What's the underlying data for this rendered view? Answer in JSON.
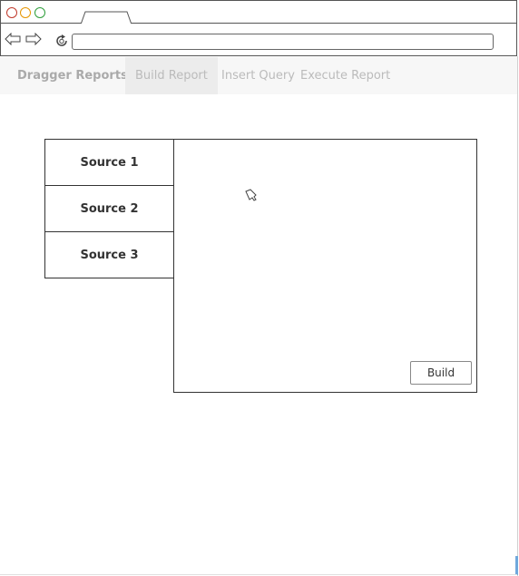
{
  "app": {
    "brand": "Dragger Reports",
    "nav": [
      {
        "label": "Build Report",
        "active": true
      },
      {
        "label": "Insert Query",
        "active": false
      },
      {
        "label": "Execute Report",
        "active": false
      }
    ]
  },
  "sources": [
    "Source 1",
    "Source 2",
    "Source 3"
  ],
  "build_area": {
    "button_label": "Build"
  },
  "icons": {
    "window_controls": [
      "close-dot",
      "minimize-dot",
      "maximize-dot"
    ],
    "back": "back-arrow-icon",
    "forward": "forward-arrow-icon",
    "reload": "reload-icon",
    "cursor": "hand-cursor-icon"
  },
  "colors": {
    "close": "#c0392b",
    "minimize": "#e69500",
    "maximize": "#2e9e3a",
    "nav_bg": "#f7f7f7",
    "nav_active_bg": "#ececec"
  }
}
